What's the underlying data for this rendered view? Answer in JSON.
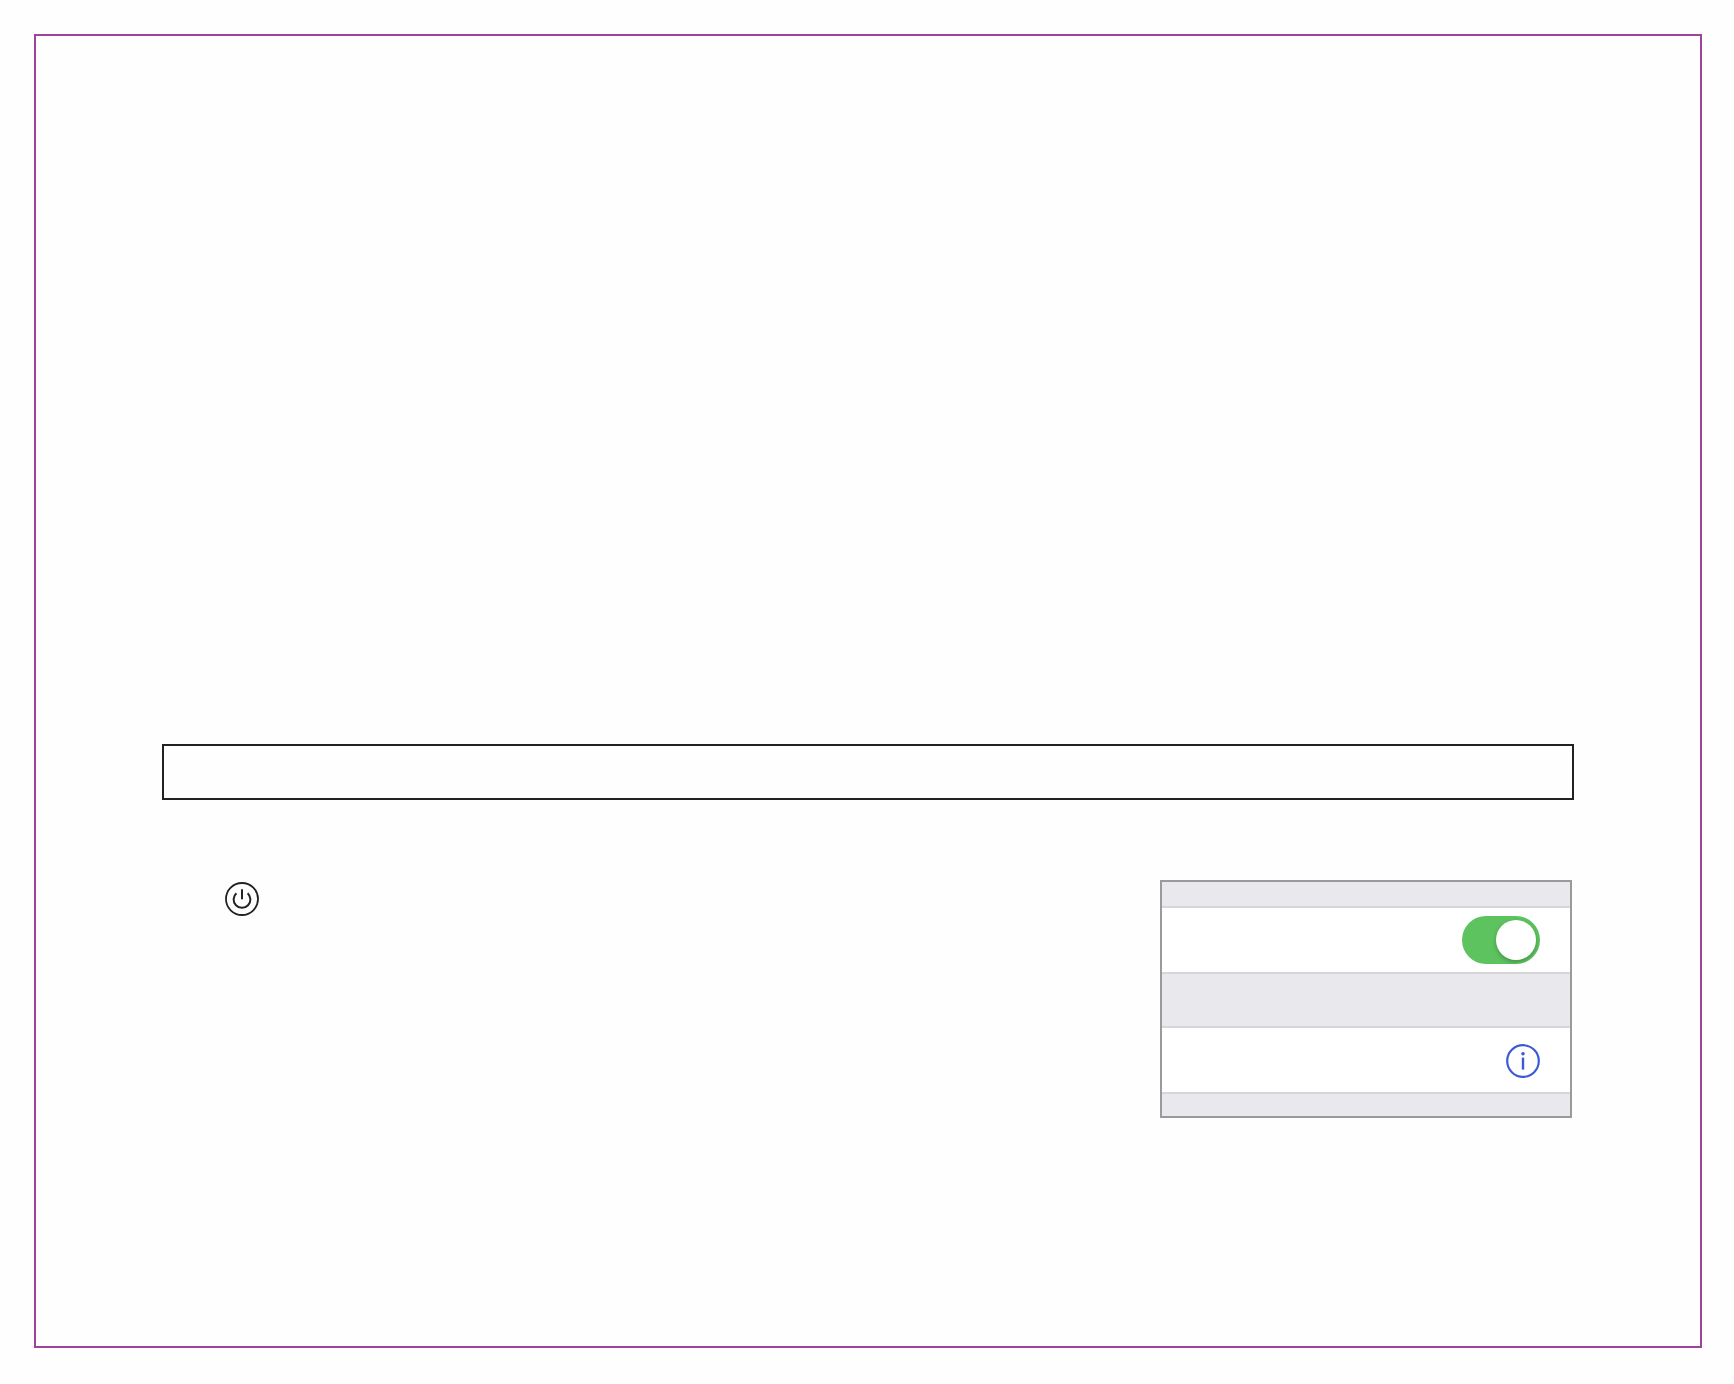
{
  "settings_panel": {
    "rows": [
      {
        "kind": "toggle",
        "on": true
      },
      {
        "kind": "info"
      }
    ]
  }
}
